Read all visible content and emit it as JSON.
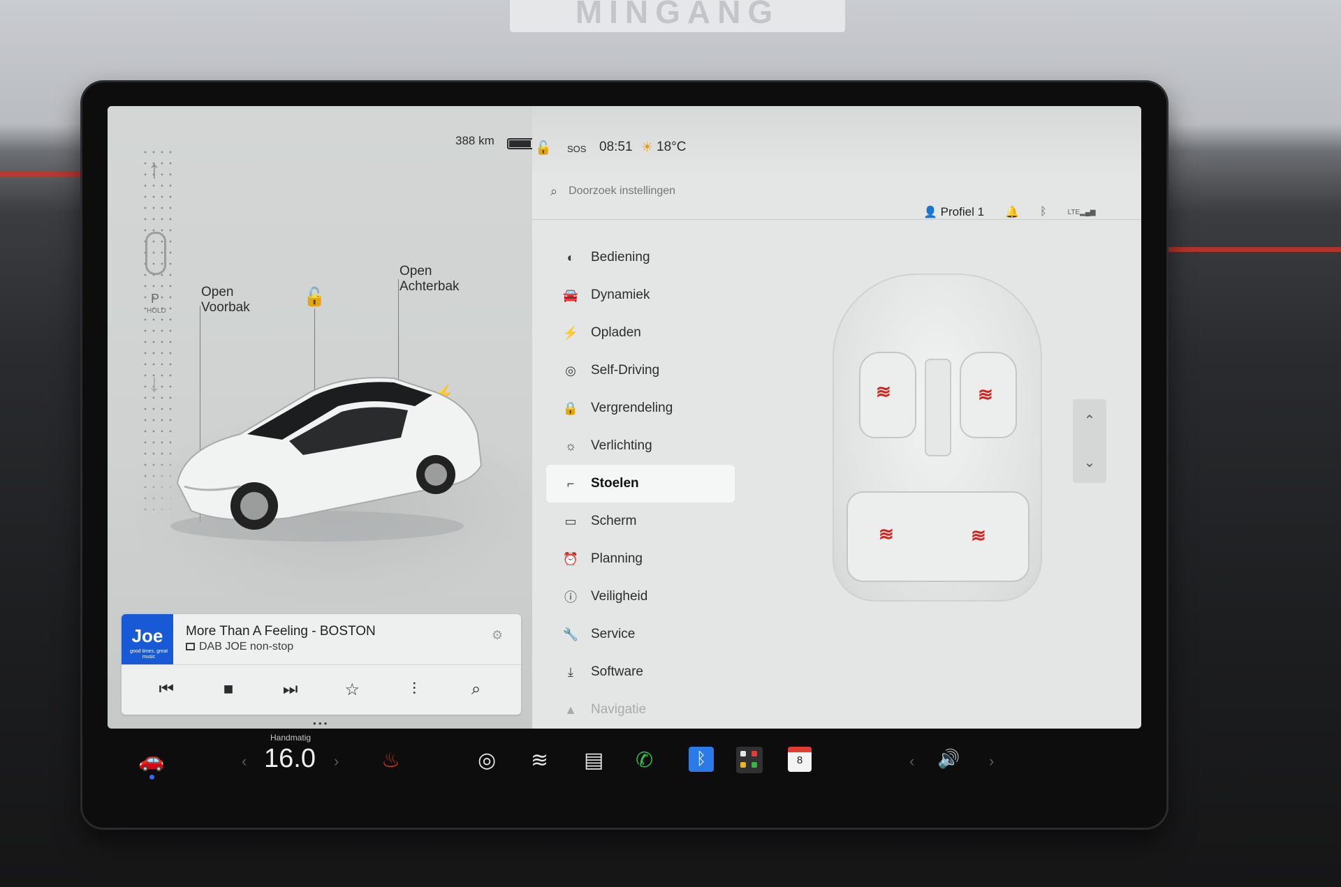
{
  "top_status": {
    "range": "388 km",
    "sos": "SOS",
    "time": "08:51",
    "temperature": "18°C"
  },
  "car_view": {
    "frunk_label": "Open\nVoorbak",
    "frunk_label_line1": "Open",
    "frunk_label_line2": "Voorbak",
    "trunk_label_line1": "Open",
    "trunk_label_line2": "Achterbak",
    "gear": "P",
    "gear_sub": "HOLD"
  },
  "media": {
    "logo_text": "Joe",
    "logo_sub": "good times, great music",
    "track": "More Than A Feeling - BOSTON",
    "station": "DAB JOE non-stop"
  },
  "settings": {
    "search_placeholder": "Doorzoek instellingen",
    "profile_name": "Profiel 1",
    "menu": [
      {
        "label": "Bediening",
        "icon": "toggle-icon"
      },
      {
        "label": "Dynamiek",
        "icon": "car-icon"
      },
      {
        "label": "Opladen",
        "icon": "bolt-icon"
      },
      {
        "label": "Self-Driving",
        "icon": "steering-wheel-icon"
      },
      {
        "label": "Vergrendeling",
        "icon": "lock-icon"
      },
      {
        "label": "Verlichting",
        "icon": "light-icon"
      },
      {
        "label": "Stoelen",
        "icon": "seat-icon",
        "active": true
      },
      {
        "label": "Scherm",
        "icon": "display-icon"
      },
      {
        "label": "Planning",
        "icon": "alarm-icon"
      },
      {
        "label": "Veiligheid",
        "icon": "warning-icon"
      },
      {
        "label": "Service",
        "icon": "wrench-icon"
      },
      {
        "label": "Software",
        "icon": "download-icon"
      },
      {
        "label": "Navigatie",
        "icon": "navigation-icon"
      }
    ]
  },
  "dock": {
    "temp_mode": "Handmatig",
    "temp_value": "16.0",
    "calendar_day": "8"
  },
  "colors": {
    "heat_red": "#d3231b",
    "bluetooth_blue": "#2a7ae8",
    "phone_green": "#2bc14d",
    "screen_bg": "#dcdfde"
  }
}
